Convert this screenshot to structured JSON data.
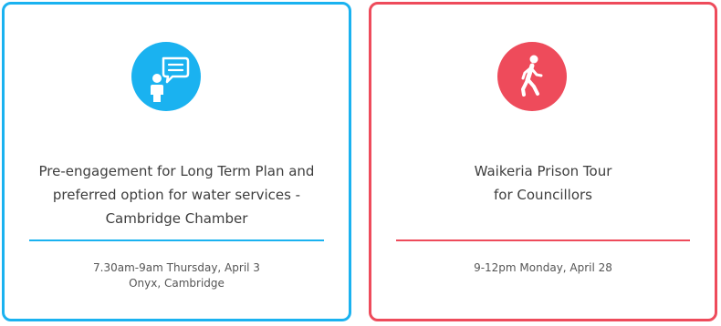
{
  "cards": [
    {
      "icon": "person-speech-bubble-icon",
      "accent": "#1ab2f0",
      "title_lines": [
        "Pre-engagement for Long Term Plan and",
        "preferred option for water services -",
        "Cambridge Chamber"
      ],
      "details_lines": [
        "7.30am-9am Thursday, April 3",
        "Onyx, Cambridge"
      ]
    },
    {
      "icon": "walking-person-icon",
      "accent": "#ee4b5b",
      "title_lines": [
        "Waikeria Prison Tour",
        "for Councillors"
      ],
      "details_lines": [
        "9-12pm Monday, April 28"
      ]
    }
  ]
}
